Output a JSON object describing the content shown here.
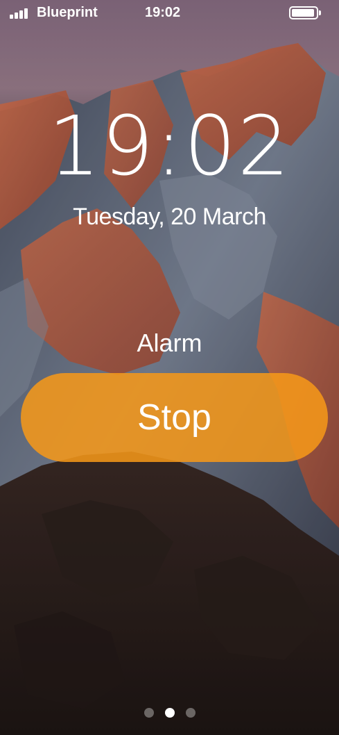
{
  "status_bar": {
    "carrier": "Blueprint",
    "time": "19:02",
    "signal_bars": 4,
    "battery_level": 0.95
  },
  "lock_screen": {
    "time": "19:02",
    "date": "Tuesday, 20 March"
  },
  "alarm": {
    "label": "Alarm",
    "stop_label": "Stop",
    "accent_color": "#F79818"
  },
  "pagination": {
    "count": 3,
    "active_index": 1
  }
}
